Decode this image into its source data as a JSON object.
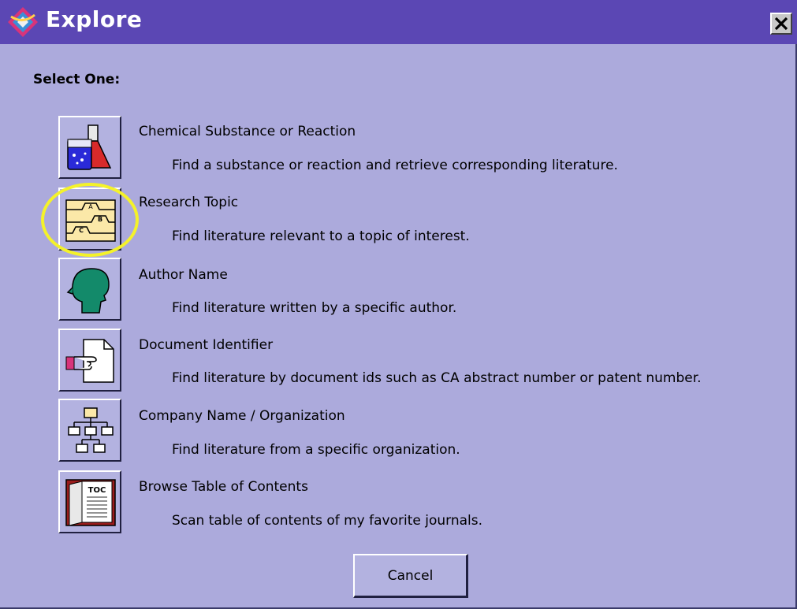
{
  "window": {
    "title": "Explore",
    "close_glyph": "✕"
  },
  "prompt": "Select One:",
  "options": [
    {
      "title": "Chemical Substance or Reaction",
      "description": "Find a substance or reaction and retrieve corresponding literature.",
      "icon": "flask-icon"
    },
    {
      "title": "Research Topic",
      "description": "Find literature relevant to a topic of interest.",
      "icon": "index-tabs-icon"
    },
    {
      "title": "Author Name",
      "description": "Find literature written by a specific author.",
      "icon": "head-silhouette-icon"
    },
    {
      "title": "Document Identifier",
      "description": "Find literature by document ids such as CA abstract number or patent number.",
      "icon": "document-pointer-icon"
    },
    {
      "title": "Company Name / Organization",
      "description": "Find literature from a specific organization.",
      "icon": "org-chart-icon"
    },
    {
      "title": "Browse Table of Contents",
      "description": "Scan table of contents of my favorite journals.",
      "icon": "toc-book-icon"
    }
  ],
  "icon_labels": {
    "tab_a": "A",
    "tab_b": "B",
    "tab_c": "C",
    "toc": "TOC"
  },
  "cancel_label": "Cancel",
  "colors": {
    "background": "#acaadc",
    "titlebar": "#5b47b4",
    "highlight": "#f4f22a"
  }
}
